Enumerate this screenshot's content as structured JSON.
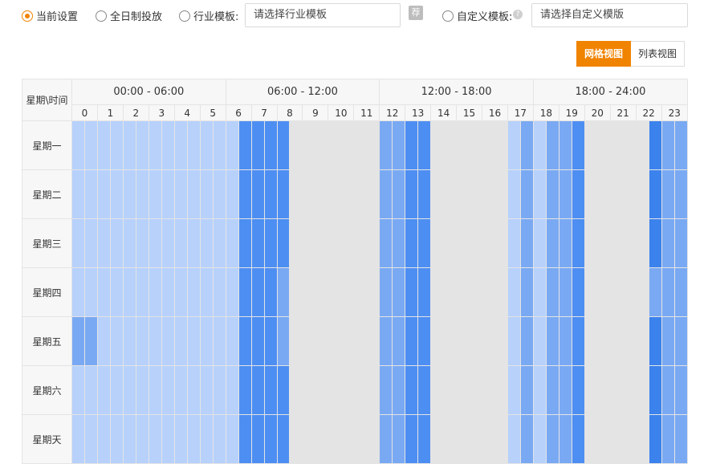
{
  "toolbar": {
    "options": [
      {
        "label": "当前设置",
        "checked": true
      },
      {
        "label": "全日制投放",
        "checked": false
      },
      {
        "label": "行业模板:",
        "checked": false
      },
      {
        "label": "自定义模板:",
        "checked": false
      }
    ],
    "industry_select_placeholder": "请选择行业模板",
    "tag_icon_text": "荐",
    "help_icon_text": "?",
    "custom_select_placeholder": "请选择自定义模版"
  },
  "view_toggle": {
    "grid_label": "网格视图",
    "list_label": "列表视图",
    "active": "grid"
  },
  "schedule": {
    "corner_label": "星期\\时间",
    "periods": [
      "00:00 - 06:00",
      "06:00 - 12:00",
      "12:00 - 18:00",
      "18:00 - 24:00"
    ],
    "hours": [
      "0",
      "1",
      "2",
      "3",
      "4",
      "5",
      "6",
      "7",
      "8",
      "9",
      "10",
      "11",
      "12",
      "13",
      "14",
      "15",
      "16",
      "17",
      "18",
      "19",
      "20",
      "21",
      "22",
      "23"
    ],
    "days": [
      {
        "label": "星期一",
        "levels": [
          1,
          1,
          1,
          1,
          1,
          1,
          1,
          1,
          1,
          1,
          1,
          1,
          1,
          3,
          3,
          3,
          3,
          0,
          0,
          0,
          0,
          0,
          0,
          0,
          2,
          2,
          3,
          3,
          0,
          0,
          0,
          0,
          0,
          0,
          1,
          2,
          1,
          2,
          2,
          3,
          0,
          0,
          0,
          0,
          0,
          4,
          2,
          2
        ]
      },
      {
        "label": "星期二",
        "levels": [
          1,
          1,
          1,
          1,
          1,
          1,
          1,
          1,
          1,
          1,
          1,
          1,
          1,
          3,
          3,
          3,
          3,
          0,
          0,
          0,
          0,
          0,
          0,
          0,
          2,
          2,
          3,
          3,
          0,
          0,
          0,
          0,
          0,
          0,
          1,
          2,
          1,
          2,
          2,
          3,
          0,
          0,
          0,
          0,
          0,
          4,
          2,
          2
        ]
      },
      {
        "label": "星期三",
        "levels": [
          1,
          1,
          1,
          1,
          1,
          1,
          1,
          1,
          1,
          1,
          1,
          1,
          1,
          3,
          3,
          3,
          3,
          0,
          0,
          0,
          0,
          0,
          0,
          0,
          2,
          2,
          3,
          3,
          0,
          0,
          0,
          0,
          0,
          0,
          1,
          2,
          1,
          2,
          2,
          3,
          0,
          0,
          0,
          0,
          0,
          4,
          2,
          2
        ]
      },
      {
        "label": "星期四",
        "levels": [
          1,
          1,
          1,
          1,
          1,
          1,
          1,
          1,
          1,
          1,
          1,
          1,
          1,
          3,
          3,
          3,
          2,
          0,
          0,
          0,
          0,
          0,
          0,
          0,
          2,
          2,
          3,
          3,
          0,
          0,
          0,
          0,
          0,
          0,
          1,
          2,
          1,
          2,
          2,
          3,
          0,
          0,
          0,
          0,
          0,
          2,
          2,
          2
        ]
      },
      {
        "label": "星期五",
        "levels": [
          2,
          2,
          1,
          1,
          1,
          1,
          1,
          1,
          1,
          1,
          1,
          1,
          1,
          3,
          3,
          3,
          2,
          0,
          0,
          0,
          0,
          0,
          0,
          0,
          2,
          2,
          3,
          3,
          0,
          0,
          0,
          0,
          0,
          0,
          1,
          2,
          1,
          2,
          2,
          3,
          0,
          0,
          0,
          0,
          0,
          4,
          2,
          2
        ]
      },
      {
        "label": "星期六",
        "levels": [
          1,
          1,
          1,
          1,
          1,
          1,
          1,
          1,
          1,
          1,
          1,
          1,
          1,
          3,
          3,
          3,
          3,
          0,
          0,
          0,
          0,
          0,
          0,
          0,
          2,
          2,
          3,
          3,
          0,
          0,
          0,
          0,
          0,
          0,
          1,
          2,
          1,
          2,
          2,
          3,
          0,
          0,
          0,
          0,
          0,
          4,
          2,
          2
        ]
      },
      {
        "label": "星期天",
        "levels": [
          1,
          1,
          1,
          1,
          1,
          1,
          1,
          1,
          1,
          1,
          1,
          1,
          1,
          3,
          3,
          3,
          3,
          0,
          0,
          0,
          0,
          0,
          0,
          0,
          2,
          2,
          3,
          3,
          0,
          0,
          0,
          0,
          0,
          0,
          1,
          2,
          1,
          2,
          2,
          3,
          0,
          0,
          0,
          0,
          0,
          4,
          2,
          2
        ]
      }
    ],
    "colors": {
      "level_0": "#e4e4e4",
      "level_1": "#b7d1fb",
      "level_2": "#7aa9f3",
      "level_3": "#4d8ef2",
      "level_4": "#3b82ed",
      "accent": "#f08300"
    }
  }
}
